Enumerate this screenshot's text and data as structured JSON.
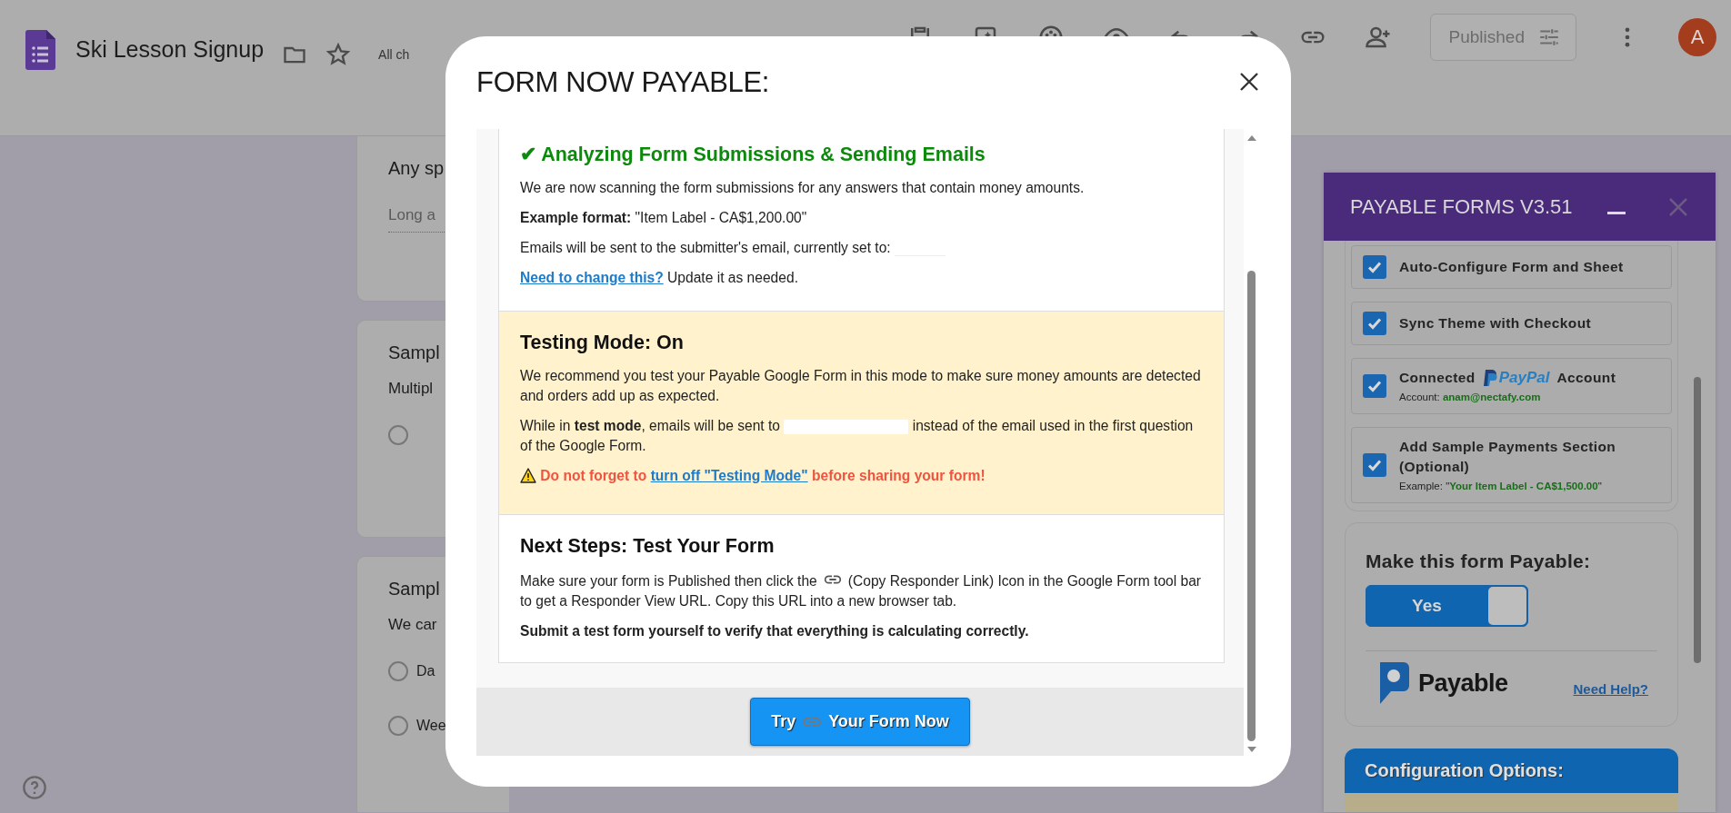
{
  "app_bar": {
    "title": "Ski Lesson Signup",
    "status_text": "All ch",
    "publish_button": "Published",
    "avatar_initial": "A"
  },
  "questions": [
    {
      "kind": "long_answer",
      "title": "Any sp",
      "hint": "Long a"
    },
    {
      "kind": "choice",
      "title": "Sampl",
      "subtitle": "Multipl",
      "options": [
        {
          "selected": false
        }
      ]
    },
    {
      "kind": "choice",
      "title": "Sampl",
      "subtitle": "We car",
      "options": [
        {
          "label": "Da",
          "selected": false
        },
        {
          "label": "Wee",
          "selected": false
        }
      ]
    }
  ],
  "modal": {
    "title": "FORM NOW PAYABLE:",
    "sections": [
      {
        "kind": "success",
        "mark": "✔",
        "heading": "Analyzing Form Submissions & Sending Emails",
        "blocks": [
          {
            "kind": "text",
            "text": "We are now scanning the form submissions for any answers that contain money amounts."
          },
          {
            "kind": "text",
            "text": "**Example format:** \"Item Label - CA$1,200.00\""
          },
          {
            "kind": "redacted",
            "before": "Emails will be sent to the submitter's email, currently set to:"
          },
          {
            "kind": "link_text",
            "link": "Need to change this?",
            "text": "Update it as needed."
          }
        ]
      },
      {
        "kind": "warning",
        "heading": "Testing Mode: On",
        "blocks": [
          {
            "kind": "text",
            "text": "We recommend you test your Payable Google Form in this mode to make sure money amounts are detected and orders add up as expected."
          },
          {
            "kind": "redacted",
            "before": "While in **test mode**, emails will be sent to",
            "after": "instead of the email used in the first question of the Google Form."
          },
          {
            "kind": "alert",
            "before": "Do not forget to",
            "link": "turn off \"Testing Mode\"",
            "after": "before sharing your form!"
          }
        ]
      },
      {
        "kind": "plain",
        "heading": "Next Steps: Test Your Form",
        "blocks": [
          {
            "kind": "icon_text",
            "before": "Make sure your form is Published then click the",
            "after": "(Copy Responder Link) Icon in the Google Form tool bar to get a Responder View URL. Copy this URL into a new browser tab."
          },
          {
            "kind": "bold",
            "text": "Submit a test form yourself to verify that everything is calculating correctly."
          }
        ]
      }
    ],
    "button": {
      "before": "Try",
      "after": "Your Form Now"
    }
  },
  "sidebar": {
    "title": "PAYABLE FORMS V3.51",
    "options": [
      {
        "kind": "simple",
        "label": "Auto-Configure Form and Sheet",
        "checked": true
      },
      {
        "kind": "simple",
        "label": "Sync Theme with Checkout",
        "checked": true
      },
      {
        "kind": "account",
        "label": "Connected",
        "brand": "PayPal",
        "label_after": "Account",
        "detail": "Account: **anam@nectafy.com**",
        "checked": true
      },
      {
        "kind": "detail",
        "label": "Add Sample Payments Section (Optional)",
        "detail": "Example: \"**Your Item Label - CA$1,500.00**\"",
        "checked": true
      }
    ],
    "payable_heading": "Make this form Payable:",
    "toggle": {
      "label": "Yes",
      "on": true
    },
    "logo_text": "Payable",
    "help_link": "Need Help?",
    "config_heading": "Configuration Options:"
  }
}
